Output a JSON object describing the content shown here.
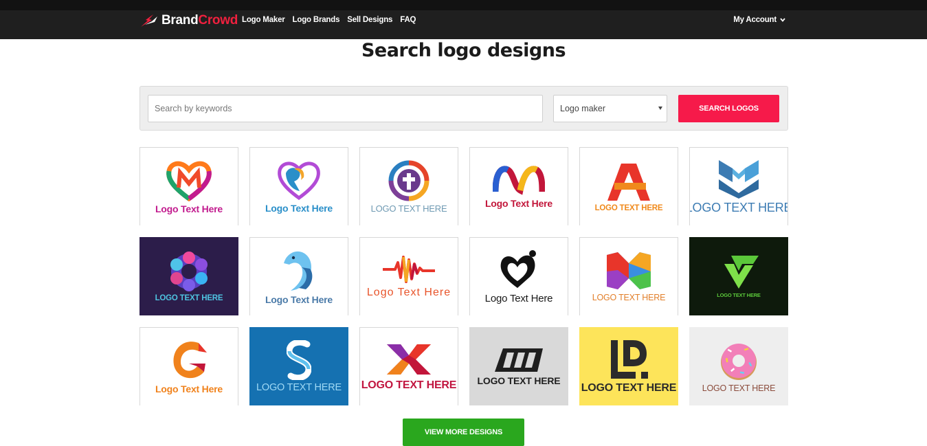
{
  "brand": {
    "part1": "Brand",
    "part2": "Crowd"
  },
  "nav": {
    "items": [
      "Logo Maker",
      "Logo Brands",
      "Sell Designs",
      "FAQ"
    ]
  },
  "account": {
    "label": "My Account"
  },
  "page": {
    "title": "Search logo designs"
  },
  "search": {
    "placeholder": "Search by keywords",
    "value": "",
    "category_selected": "Logo maker",
    "button_label": "SEARCH LOGOS"
  },
  "logos": [
    {
      "label": "Logo Text Here",
      "color": "#c21b8e",
      "bg": "#ffffff",
      "icon": "heart-m-icon"
    },
    {
      "label": "Logo Text Here",
      "color": "#2a8fc9",
      "bg": "#ffffff",
      "icon": "heart-dog-icon"
    },
    {
      "label": "LOGO TEXT HERE",
      "color": "#6f9ab3",
      "bg": "#ffffff",
      "icon": "cross-circle-icon"
    },
    {
      "label": "Logo Text Here",
      "color": "#c2163a",
      "bg": "#ffffff",
      "icon": "ribbon-m-icon"
    },
    {
      "label": "LOGO TEXT HERE",
      "color": "#f08a1c",
      "bg": "#ffffff",
      "icon": "letter-a-icon"
    },
    {
      "label": "LOGO TEXT HERE",
      "color": "#3d7cb3",
      "bg": "#ffffff",
      "icon": "chevron-m-icon"
    },
    {
      "label": "LOGO TEXT HERE",
      "color": "#4ec3e0",
      "bg": "#2c1d4a",
      "icon": "gem-flower-icon"
    },
    {
      "label": "Logo Text Here",
      "color": "#4a7aa8",
      "bg": "#ffffff",
      "icon": "dolphin-icon"
    },
    {
      "label": "Logo Text Here",
      "color": "#e8542a",
      "bg": "#ffffff",
      "icon": "soundwave-icon"
    },
    {
      "label": "Logo Text Here",
      "color": "#1a1a1a",
      "bg": "#ffffff",
      "icon": "heart-family-icon"
    },
    {
      "label": "LOGO TEXT HERE",
      "color": "#e27f2a",
      "bg": "#ffffff",
      "icon": "cube-x-icon"
    },
    {
      "label": "LOGO TEXT HERE",
      "color": "#5bc83a",
      "bg": "#0e1a0c",
      "icon": "letter-v-icon"
    },
    {
      "label": "Logo Text Here",
      "color": "#f0821c",
      "bg": "#ffffff",
      "icon": "letter-g-icon"
    },
    {
      "label": "LOGO TEXT HERE",
      "color": "#9fd9f5",
      "bg": "#1571b1",
      "icon": "letter-s-icon"
    },
    {
      "label": "LOGO TEXT HERE",
      "color": "#c1153f",
      "bg": "#ffffff",
      "icon": "letter-x-icon"
    },
    {
      "label": "LOGO TEXT HERE",
      "color": "#1f1f1f",
      "bg": "#d9d9d9",
      "icon": "speed-m-icon"
    },
    {
      "label": "LOGO TEXT HERE",
      "color": "#2b2b2b",
      "bg": "#fde45a",
      "icon": "letters-ld-icon"
    },
    {
      "label": "LOGO TEXT HERE",
      "color": "#8a4a3a",
      "bg": "#eeeeee",
      "icon": "donut-icon"
    }
  ],
  "view_more": {
    "label": "VIEW MORE DESIGNS"
  },
  "colors": {
    "accent_red": "#f61a4a",
    "accent_green": "#2aa71e",
    "header": "#1f1f1f"
  }
}
